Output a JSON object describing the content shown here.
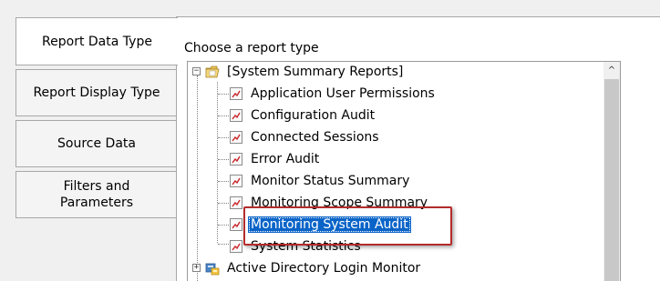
{
  "tabs": [
    {
      "label": "Report Data Type",
      "active": true
    },
    {
      "label": "Report Display Type",
      "active": false
    },
    {
      "label": "Source Data",
      "active": false
    },
    {
      "label": "Filters and\nParameters",
      "active": false
    }
  ],
  "panel": {
    "title": "Choose a report type"
  },
  "tree": {
    "group_label": "[System Summary Reports]",
    "group_expander": "−",
    "items": [
      {
        "label": "Application User Permissions",
        "icon": "report-icon"
      },
      {
        "label": "Configuration Audit",
        "icon": "report-icon"
      },
      {
        "label": "Connected Sessions",
        "icon": "report-icon"
      },
      {
        "label": "Error Audit",
        "icon": "report-icon"
      },
      {
        "label": "Monitor Status Summary",
        "icon": "report-icon"
      },
      {
        "label": "Monitoring Scope Summary",
        "icon": "report-icon"
      },
      {
        "label": "Monitoring System Audit",
        "icon": "report-icon",
        "selected": true
      },
      {
        "label": "System Statistics",
        "icon": "report-icon"
      }
    ],
    "next_group_label": "Active Directory Login Monitor",
    "next_group_expander": "+"
  },
  "colors": {
    "selection": "#0a64c8",
    "highlight_border": "#b52b2b"
  },
  "scrollbar": {
    "up_arrow": "^"
  }
}
